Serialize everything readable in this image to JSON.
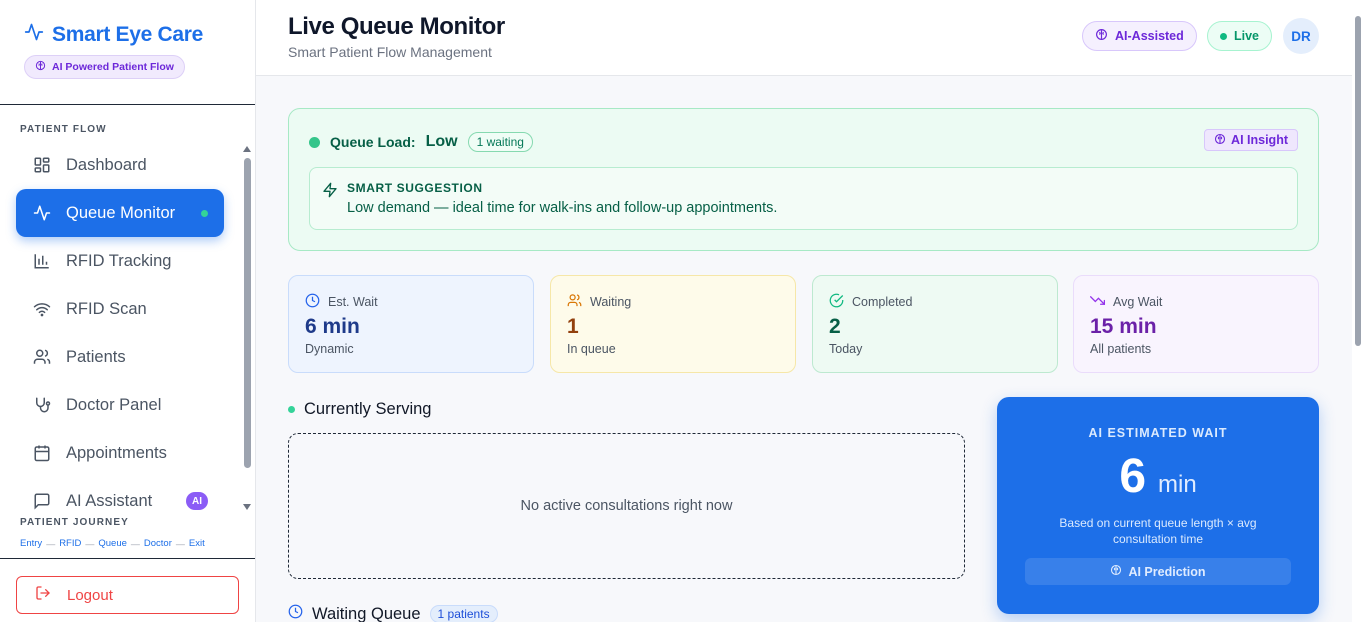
{
  "brand": {
    "title": "Smart Eye Care",
    "badge": "AI Powered Patient Flow"
  },
  "sidebar": {
    "section_label": "PATIENT FLOW",
    "items": [
      {
        "label": "Dashboard",
        "icon": "grid-icon"
      },
      {
        "label": "Queue Monitor",
        "icon": "activity-icon",
        "active": true
      },
      {
        "label": "RFID Tracking",
        "icon": "bar-chart-icon"
      },
      {
        "label": "RFID Scan",
        "icon": "wifi-icon"
      },
      {
        "label": "Patients",
        "icon": "users-icon"
      },
      {
        "label": "Doctor Panel",
        "icon": "stethoscope-icon"
      },
      {
        "label": "Appointments",
        "icon": "calendar-icon"
      },
      {
        "label": "AI Assistant",
        "icon": "message-icon",
        "badge": "AI"
      }
    ],
    "journey_label": "PATIENT JOURNEY",
    "journey": [
      "Entry",
      "RFID",
      "Queue",
      "Doctor",
      "Exit"
    ],
    "logout": "Logout"
  },
  "header": {
    "title": "Live Queue Monitor",
    "subtitle": "Smart Patient Flow Management",
    "ai_badge": "AI-Assisted",
    "live_badge": "Live",
    "avatar": "DR"
  },
  "queue_load": {
    "label": "Queue Load:",
    "value": "Low",
    "waiting": "1 waiting",
    "insight": "AI Insight",
    "suggestion_title": "SMART SUGGESTION",
    "suggestion_text": "Low demand — ideal time for walk-ins and follow-up appointments."
  },
  "stats": [
    {
      "label": "Est. Wait",
      "value": "6 min",
      "sub": "Dynamic"
    },
    {
      "label": "Waiting",
      "value": "1",
      "sub": "In queue"
    },
    {
      "label": "Completed",
      "value": "2",
      "sub": "Today"
    },
    {
      "label": "Avg Wait",
      "value": "15 min",
      "sub": "All patients"
    }
  ],
  "serving": {
    "title": "Currently Serving",
    "empty": "No active consultations right now"
  },
  "waiting_queue": {
    "title": "Waiting Queue",
    "count": "1 patients"
  },
  "ai_estimate": {
    "title": "AI ESTIMATED WAIT",
    "value": "6",
    "unit": "min",
    "description": "Based on current queue length × avg consultation time",
    "button": "AI Prediction"
  },
  "colors": {
    "primary": "#1d6fe8",
    "success": "#34c58a",
    "ai": "#6d28d9",
    "danger": "#ef4444"
  }
}
